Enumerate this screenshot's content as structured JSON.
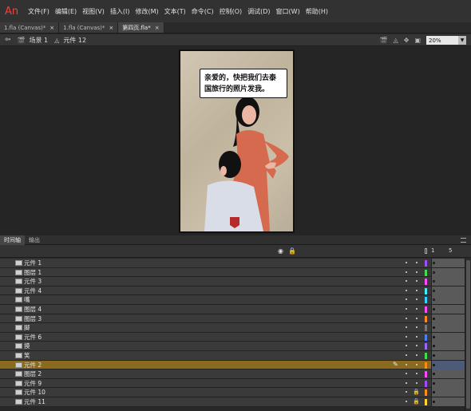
{
  "app": {
    "logo": "An"
  },
  "menu": [
    "文件(F)",
    "编辑(E)",
    "视图(V)",
    "插入(I)",
    "修改(M)",
    "文本(T)",
    "命令(C)",
    "控制(O)",
    "调试(D)",
    "窗口(W)",
    "帮助(H)"
  ],
  "tabs": [
    {
      "label": "1.fla (Canvas)*",
      "active": false
    },
    {
      "label": "1.fla (Canvas)*",
      "active": false
    },
    {
      "label": "第四页.fla*",
      "active": true
    }
  ],
  "tab_close": "×",
  "editbar": {
    "back": "⇦",
    "scene_label": "场景 1",
    "symbol_label": "元件 12",
    "zoom": "20%"
  },
  "stage": {
    "bubble_text": "亲爱的，快把我们去泰国旅行的照片发我。"
  },
  "panel_tabs": [
    {
      "label": "时间轴",
      "active": true
    },
    {
      "label": "输出",
      "active": false
    }
  ],
  "timeline": {
    "eye_icon": "◉",
    "lock_icon": "🔒",
    "frame_1": "1",
    "frame_5": "5"
  },
  "layers": [
    {
      "name": "元件 1",
      "color": "#a04cff",
      "keyframe": "hollow"
    },
    {
      "name": "图层 1",
      "color": "#3fe04c",
      "keyframe": "hollow"
    },
    {
      "name": "元件 3",
      "color": "#ff4cff",
      "keyframe": "hollow"
    },
    {
      "name": "元件 4",
      "color": "#3ef0ff",
      "keyframe": "hollow"
    },
    {
      "name": "嘴",
      "color": "#2fd4ff",
      "keyframe": "hollow"
    },
    {
      "name": "图层 4",
      "color": "#ff4cff",
      "keyframe": "solid"
    },
    {
      "name": "图层 3",
      "color": "#ff8c1a",
      "keyframe": "solid"
    },
    {
      "name": "脚",
      "color": "#777777",
      "keyframe": "solid"
    },
    {
      "name": "元件 6",
      "color": "#4c7dff",
      "keyframe": "solid"
    },
    {
      "name": "摸",
      "color": "#9966ff",
      "keyframe": "solid"
    },
    {
      "name": "笑",
      "color": "#3fe04c",
      "keyframe": "solid"
    },
    {
      "name": "元件 2",
      "color": "#ff8c1a",
      "keyframe": "solid",
      "selected": true
    },
    {
      "name": "图层 2",
      "color": "#ff4cff",
      "keyframe": "solid"
    },
    {
      "name": "元件 9",
      "color": "#a04cff",
      "keyframe": "solid"
    },
    {
      "name": "元件 10",
      "color": "#ff8c1a",
      "keyframe": "solid",
      "locked": true
    },
    {
      "name": "元件 11",
      "color": "#ffd633",
      "keyframe": "solid",
      "locked": true
    }
  ]
}
